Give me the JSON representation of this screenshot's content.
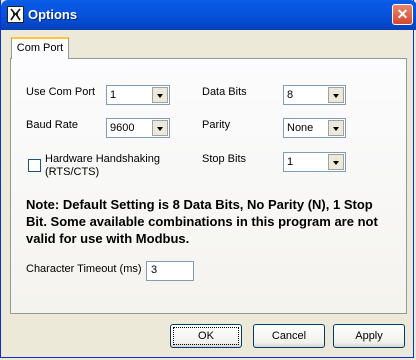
{
  "window": {
    "title": "Options"
  },
  "tabs": [
    {
      "label": "Com Port"
    }
  ],
  "fields": {
    "use_com_port": {
      "label": "Use Com Port",
      "value": "1"
    },
    "baud_rate": {
      "label": "Baud Rate",
      "value": "9600"
    },
    "hardware_handshaking": {
      "label_line1": "Hardware Handshaking",
      "label_line2": "(RTS/CTS)",
      "checked": false
    },
    "data_bits": {
      "label": "Data Bits",
      "value": "8"
    },
    "parity": {
      "label": "Parity",
      "value": "None"
    },
    "stop_bits": {
      "label": "Stop Bits",
      "value": "1"
    },
    "note": "Note: Default Setting is 8 Data Bits, No Parity (N), 1 Stop Bit. Some available combinations in this program are not valid for use with Modbus.",
    "character_timeout": {
      "label": "Character Timeout (ms)",
      "value": "3"
    }
  },
  "buttons": {
    "ok": "OK",
    "cancel": "Cancel",
    "apply": "Apply"
  },
  "icons": {
    "close": "close-icon",
    "app": "app-icon"
  }
}
